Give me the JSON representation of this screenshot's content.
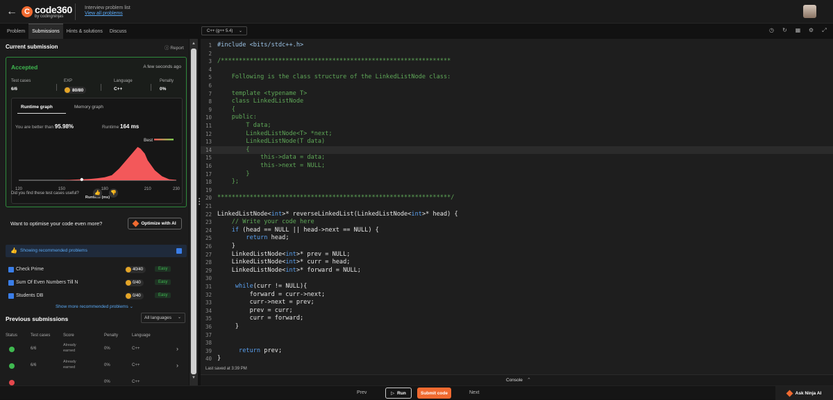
{
  "header": {
    "logo_mark": "C",
    "logo_name": "code360",
    "logo_by": "by codingninjas",
    "breadcrumb_top": "Interview problem list",
    "breadcrumb_link": "View all problems"
  },
  "tabs": [
    "Problem",
    "Submissions",
    "Hints & solutions",
    "Discuss"
  ],
  "editor_toolbar": {
    "language": "C++ (g++ 5.4)",
    "icons": [
      "timer-icon",
      "reset-icon",
      "layout-icon",
      "settings-icon",
      "fullscreen-icon"
    ]
  },
  "submission": {
    "title": "Current submission",
    "report": "Report",
    "status": "Accepted",
    "time": "A few seconds ago",
    "stats": [
      {
        "label": "Test cases",
        "value": "6/6"
      },
      {
        "label": "EXP",
        "value": "80/80"
      },
      {
        "label": "Language",
        "value": "C++"
      },
      {
        "label": "Penalty",
        "value": "0%"
      }
    ],
    "graph_tabs": [
      "Runtime graph",
      "Memory graph"
    ],
    "better_than_label": "You are better than",
    "better_than_value": "95.98%",
    "runtime_label": "Runtime",
    "runtime_value": "164 ms",
    "feedback": "Did you find these test cases useful?"
  },
  "chart_data": {
    "type": "area",
    "title": "",
    "xlabel": "Runtime (ms)",
    "ylabel": "",
    "xticks": [
      120,
      150,
      180,
      210,
      230
    ],
    "xlim": [
      120,
      230
    ],
    "legend": "Best",
    "highlight_x": 164,
    "x": [
      120,
      140,
      150,
      160,
      170,
      175,
      180,
      185,
      190,
      195,
      200,
      203,
      205,
      208,
      210,
      215,
      220,
      225,
      230
    ],
    "y": [
      0,
      0,
      0,
      0.02,
      0.04,
      0.06,
      0.09,
      0.15,
      0.35,
      0.6,
      0.85,
      1.0,
      0.95,
      0.8,
      0.6,
      0.3,
      0.12,
      0.03,
      0.01
    ],
    "colors": {
      "fill": "#f3585a",
      "line": "#f8f8f8",
      "best_gradient_start": "#f3585a",
      "best_gradient_end": "#7dcf4f"
    }
  },
  "optimise": {
    "text": "Want to optimise your code even more?",
    "button": "Optimize with AI"
  },
  "recommended": {
    "label": "Showing recommended problems",
    "problems": [
      {
        "name": "Check Prime",
        "points": "40/40",
        "difficulty": "Easy"
      },
      {
        "name": "Sum Of Even Numbers Till N",
        "points": "0/40",
        "difficulty": "Easy"
      },
      {
        "name": "Students DB",
        "points": "0/40",
        "difficulty": "Easy"
      }
    ],
    "show_more": "Show more recommended problems"
  },
  "previous": {
    "title": "Previous submissions",
    "filter": "All languages",
    "columns": [
      "Status",
      "Test cases",
      "Score",
      "Penalty",
      "Language"
    ],
    "rows": [
      {
        "test_cases": "6/6",
        "score_line1": "Already",
        "score_line2": "earned",
        "penalty": "0%",
        "language": "C++"
      },
      {
        "test_cases": "6/6",
        "score_line1": "Already",
        "score_line2": "earned",
        "penalty": "0%",
        "language": "C++"
      },
      {
        "test_cases": "",
        "score_line1": "",
        "score_line2": "",
        "penalty": "0%",
        "language": "C++"
      }
    ]
  },
  "code_lines": [
    "#include <bits/stdc++.h>",
    "",
    "/****************************************************************",
    "",
    "    Following is the class structure of the LinkedListNode class:",
    "",
    "    template <typename T>",
    "    class LinkedListNode",
    "    {",
    "    public:",
    "        T data;",
    "        LinkedListNode<T> *next;",
    "        LinkedListNode(T data)",
    "        {",
    "            this->data = data;",
    "            this->next = NULL;",
    "        }",
    "    };",
    "",
    "*****************************************************************/",
    "",
    "LinkedListNode<int>* reverseLinkedList(LinkedListNode<int>* head) {",
    "    // Write your code here",
    "    if (head == NULL || head->next == NULL) {",
    "        return head;",
    "    }",
    "    LinkedListNode<int>* prev = NULL;",
    "    LinkedListNode<int>* curr = head;",
    "    LinkedListNode<int>* forward = NULL;",
    "",
    "     while(curr != NULL){",
    "         forward = curr->next;",
    "         curr->next = prev;",
    "         prev = curr;",
    "         curr = forward;",
    "     }",
    "",
    "",
    "      return prev;",
    "}",
    ""
  ],
  "editor": {
    "highlight_line": 14,
    "last_saved": "Last saved at 3:39 PM",
    "console": "Console"
  },
  "footer": {
    "prev": "Prev",
    "run": "Run",
    "submit": "Submit code",
    "next": "Next",
    "ask": "Ask Ninja AI"
  }
}
